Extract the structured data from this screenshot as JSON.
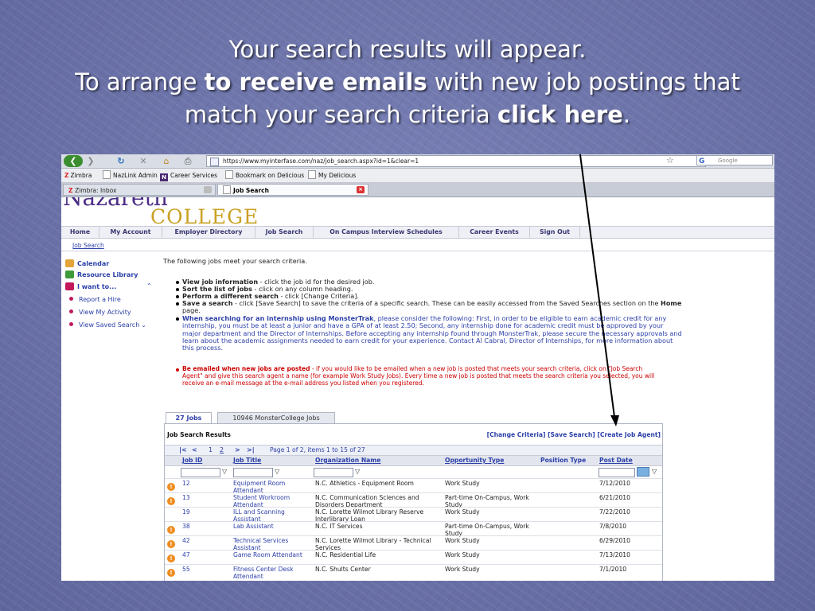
{
  "slide": {
    "title_line1": "Your search results will appear.",
    "title_pre": "To arrange ",
    "title_bold1": "to receive emails",
    "title_mid": " with new job postings that",
    "title_line3_pre": "match your search criteria ",
    "title_bold2": "click here",
    "title_end": "."
  },
  "browser": {
    "url": "https://www.myinterfase.com/naz/job_search.aspx?id=1&clear=1",
    "search_placeholder": "Google",
    "bookmarks": [
      "Zimbra",
      "NazLink Admin",
      "Career Services",
      "Bookmark on Delicious",
      "My Delicious"
    ],
    "tabs": [
      "Zimbra: Inbox",
      "Job Search"
    ]
  },
  "site": {
    "logo_top": "Nazareth",
    "logo_college": "COLLEGE",
    "menu": [
      "Home",
      "My Account",
      "Employer Directory",
      "Job Search",
      "On Campus Interview Schedules",
      "Career Events",
      "Sign Out"
    ],
    "breadcrumb": "Job Search"
  },
  "sidebar": {
    "calendar": "Calendar",
    "resource_library": "Resource Library",
    "i_want_to": "I want to...",
    "items": [
      "Report a Hire",
      "View My Activity",
      "View Saved Search"
    ]
  },
  "main": {
    "intro": "The following jobs meet your search criteria.",
    "b1_bold": "View job information",
    "b1_text": " - click the job id for the desired job.",
    "b2_bold": "Sort the list of jobs",
    "b2_text": " - click on any column heading.",
    "b3_bold": "Perform a different search",
    "b3_text": " - click [Change Criteria].",
    "b4_bold": "Save a search",
    "b4_text": " - click [Save Search] to save the criteria of a specific search. These can be easily accessed from the Saved Searches section on the ",
    "b4_home": "Home",
    "b4_end": " page.",
    "b5_bold": "When searching for an internship using MonsterTrak",
    "b5_text": ", please consider the following: First, in order to be eligible to earn academic credit for any internship, you must be at least a junior and have a GPA of at least 2.50; Second, any internship done for academic credit must be approved by your major department and the Director of Internships. Before accepting any internship found through MonsterTrak, please secure the necessary approvals and learn about the academic assignments needed to earn credit for your experience. Contact Al Cabral, Director of Internships, for more information about this process.",
    "b6_bold": "Be emailed when new jobs are posted",
    "b6_text": " - if you would like to be emailed when a new job is posted that meets your search criteria, click on \"Job Search Agent\" and give this search agent a name (for example Work Study Jobs). Every time a new job is posted that meets the search criteria you selected, you will receive an e-mail message at the e-mail address you listed when you registered."
  },
  "results": {
    "tabs": [
      "27 Jobs",
      "10946 MonsterCollege Jobs"
    ],
    "heading": "Job Search Results",
    "actions": "[Change Criteria] [Save Search] [Create Job Agent]",
    "pager_first": "|<",
    "pager_prev": "<",
    "page1": "1",
    "page2": "2",
    "pager_next": ">",
    "pager_last": ">|",
    "pager_text": "Page 1 of 2, items 1 to 15 of 27",
    "columns": [
      "Job ID",
      "Job Title",
      "Organization Name",
      "Opportunity Type",
      "Position Type",
      "Post Date"
    ],
    "rows": [
      {
        "id": "12",
        "title": "Equipment Room Attendant",
        "org": "N.C. Athletics - Equipment Room",
        "type": "Work Study",
        "date": "7/12/2010",
        "warn": true
      },
      {
        "id": "13",
        "title": "Student Workroom Attendant",
        "org": "N.C. Communication Sciences and Disorders Department",
        "type": "Part-time On-Campus, Work Study",
        "date": "6/21/2010",
        "warn": true
      },
      {
        "id": "19",
        "title": "ILL and Scanning Assistant",
        "org": "N.C. Lorette Wilmot Library Reserve Interlibrary Loan",
        "type": "Work Study",
        "date": "7/22/2010",
        "warn": false
      },
      {
        "id": "38",
        "title": "Lab Assistant",
        "org": "N.C. IT Services",
        "type": "Part-time On-Campus, Work Study",
        "date": "7/8/2010",
        "warn": true
      },
      {
        "id": "42",
        "title": "Technical Services Assistant",
        "org": "N.C. Lorette Wilmot Library - Technical Services",
        "type": "Work Study",
        "date": "6/29/2010",
        "warn": true
      },
      {
        "id": "47",
        "title": "Game Room Attendant",
        "org": "N.C. Residential Life",
        "type": "Work Study",
        "date": "7/13/2010",
        "warn": true
      },
      {
        "id": "55",
        "title": "Fitness Center Desk Attendant",
        "org": "N.C. Shults Center",
        "type": "Work Study",
        "date": "7/1/2010",
        "warn": true
      }
    ],
    "warn_glyph": "!"
  }
}
